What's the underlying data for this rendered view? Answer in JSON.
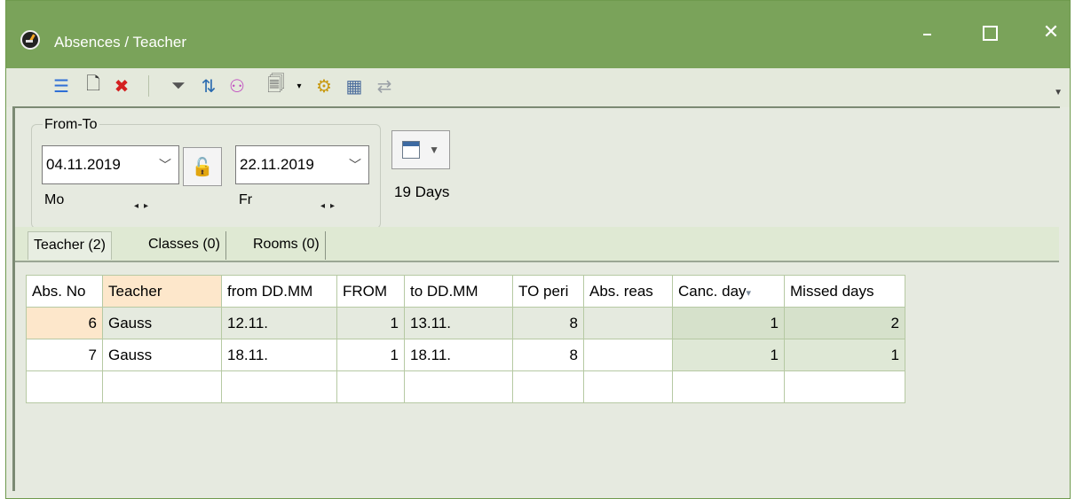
{
  "window": {
    "title": "Absences / Teacher",
    "controls": {
      "minimize": "–",
      "maximize": "□",
      "close": "✕"
    }
  },
  "toolbar": {
    "items": [
      {
        "name": "list-icon",
        "glyph": "☰",
        "color": "#2f6fd6"
      },
      {
        "name": "new-icon",
        "glyph": "🗋",
        "color": "#333333"
      },
      {
        "name": "delete-icon",
        "glyph": "✖",
        "color": "#d42020"
      },
      {
        "name": "filter-icon",
        "glyph": "⏷",
        "color": "#555555"
      },
      {
        "name": "sort-icon",
        "glyph": "⇅",
        "color": "#2a6bb0"
      },
      {
        "name": "people-icon",
        "glyph": "⚇",
        "color": "#c04cc0"
      },
      {
        "name": "report-icon",
        "glyph": "🗐",
        "color": "#666666"
      },
      {
        "name": "settings-icon",
        "glyph": "⚙",
        "color": "#c89a12"
      },
      {
        "name": "calendar-grid-icon",
        "glyph": "▦",
        "color": "#4a6c9c"
      },
      {
        "name": "export-icon",
        "glyph": "⇄",
        "color": "#9aa0a6"
      }
    ]
  },
  "date_range": {
    "legend": "From-To",
    "from_date": "04.11.2019",
    "from_day": "Mo",
    "to_date": "22.11.2019",
    "to_day": "Fr",
    "days_label": "19 Days"
  },
  "tabs": [
    {
      "label": "Teacher (2)",
      "active": true
    },
    {
      "label": "Classes (0)",
      "active": false
    },
    {
      "label": "Rooms (0)",
      "active": false
    }
  ],
  "table": {
    "columns": [
      "Abs. No",
      "Teacher",
      "from DD.MM",
      "FROM",
      "to DD.MM",
      "TO peri",
      "Abs. reas",
      "Canc. day",
      "Missed days"
    ],
    "rows": [
      [
        "6",
        "Gauss",
        "12.11.",
        "1",
        "13.11.",
        "8",
        "",
        "1",
        "2"
      ],
      [
        "7",
        "Gauss",
        "18.11.",
        "1",
        "18.11.",
        "8",
        "",
        "1",
        "1"
      ]
    ]
  },
  "colors": {
    "title_bar": "#7aa35a",
    "selection_orange": "#fde7cb",
    "panel_green": "#e6eae0"
  }
}
